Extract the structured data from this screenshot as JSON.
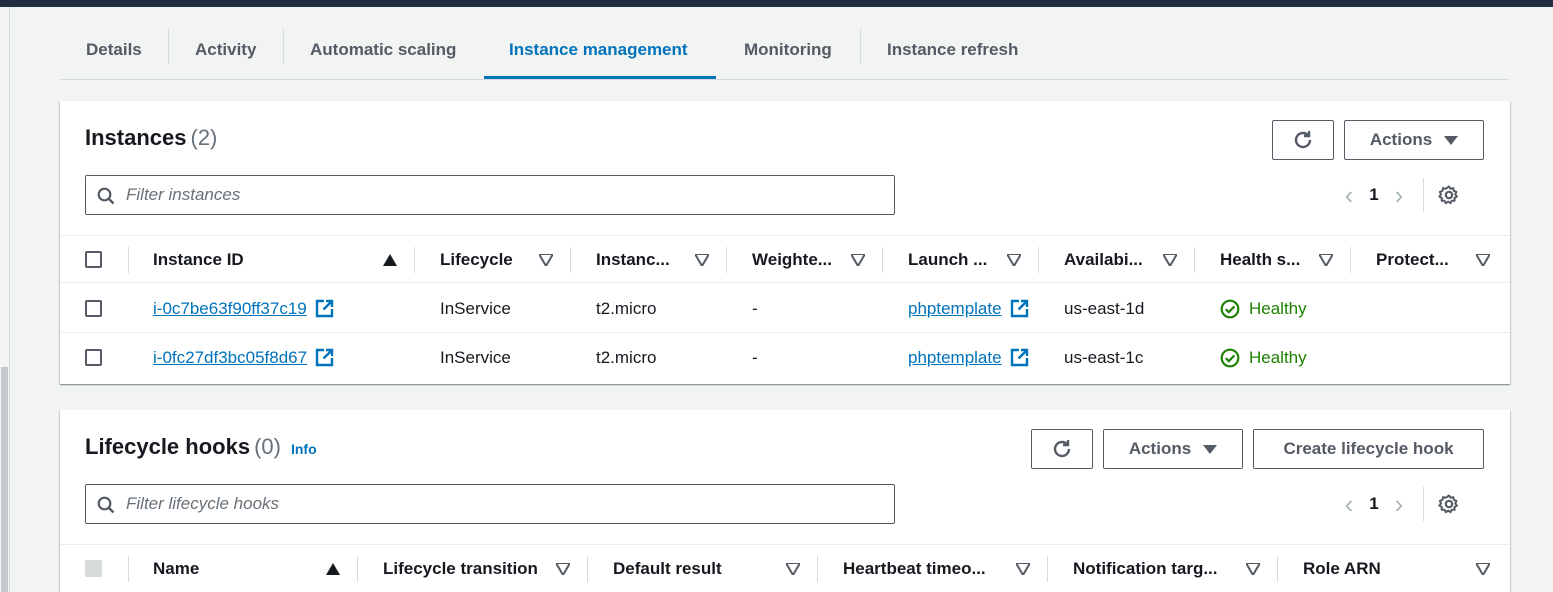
{
  "tabs": [
    {
      "label": "Details"
    },
    {
      "label": "Activity"
    },
    {
      "label": "Automatic scaling"
    },
    {
      "label": "Instance management"
    },
    {
      "label": "Monitoring"
    },
    {
      "label": "Instance refresh"
    }
  ],
  "active_tab": "Instance management",
  "colors": {
    "accent": "#0073bb",
    "healthy": "#1d8102",
    "topbar": "#232f3e"
  },
  "instances": {
    "title": "Instances",
    "count": "(2)",
    "actions_label": "Actions",
    "filter_placeholder": "Filter instances",
    "page": "1",
    "columns": [
      "Instance ID",
      "Lifecycle",
      "Instanc...",
      "Weighte...",
      "Launch ...",
      "Availabi...",
      "Health s...",
      "Protect..."
    ],
    "rows": [
      {
        "id": "i-0c7be63f90ff37c19",
        "lifecycle": "InService",
        "type": "t2.micro",
        "weight": "-",
        "launch": "phptemplate",
        "az": "us-east-1d",
        "health": "Healthy"
      },
      {
        "id": "i-0fc27df3bc05f8d67",
        "lifecycle": "InService",
        "type": "t2.micro",
        "weight": "-",
        "launch": "phptemplate",
        "az": "us-east-1c",
        "health": "Healthy"
      }
    ]
  },
  "hooks": {
    "title": "Lifecycle hooks",
    "count": "(0)",
    "info_label": "Info",
    "actions_label": "Actions",
    "create_label": "Create lifecycle hook",
    "filter_placeholder": "Filter lifecycle hooks",
    "page": "1",
    "columns": [
      "Name",
      "Lifecycle transition",
      "Default result",
      "Heartbeat timeo...",
      "Notification targ...",
      "Role ARN"
    ]
  },
  "icons": {
    "refresh": "refresh-icon",
    "search": "search-icon",
    "settings": "gear-icon",
    "external": "external-link-icon",
    "status_ok": "check-circle-icon"
  }
}
